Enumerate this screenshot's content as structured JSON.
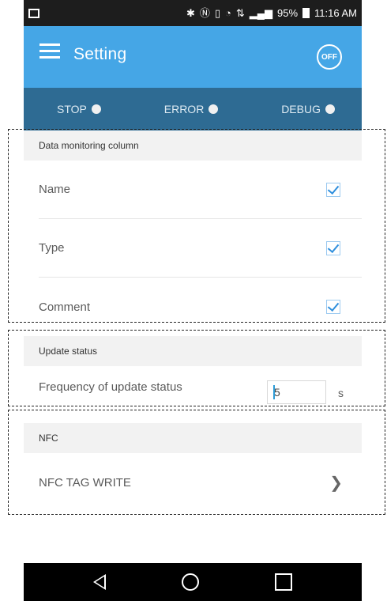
{
  "status_bar": {
    "left_icon": "gallery-icon",
    "right_icons": [
      "bluetooth-icon",
      "nfc-icon",
      "vibrate-icon",
      "wifi-icon",
      "data-icon",
      "signal-icon"
    ],
    "battery": "95%",
    "time": "11:16 AM"
  },
  "app_bar": {
    "title": "Setting",
    "off_label": "OFF",
    "color": "#45a6e6"
  },
  "indicators": [
    {
      "label": "STOP"
    },
    {
      "label": "ERROR"
    },
    {
      "label": "DEBUG"
    }
  ],
  "sections": {
    "data_monitoring": {
      "header": "Data monitoring column",
      "items": [
        {
          "label": "Name",
          "checked": true
        },
        {
          "label": "Type",
          "checked": true
        },
        {
          "label": "Comment",
          "checked": true
        }
      ]
    },
    "update_status": {
      "header": "Update status",
      "label": "Frequency of update status",
      "value": "5",
      "unit": "s"
    },
    "nfc": {
      "header": "NFC",
      "item_label": "NFC TAG WRITE"
    }
  },
  "nav_bar": {
    "buttons": [
      "back-icon",
      "home-icon",
      "recent-apps-icon"
    ]
  }
}
